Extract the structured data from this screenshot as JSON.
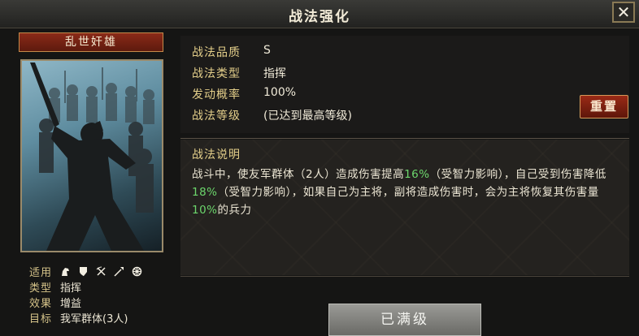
{
  "header": {
    "title": "战法强化",
    "close_icon": "close-icon"
  },
  "card": {
    "name": "乱世奸雄",
    "portrait_icon": "warrior-portrait-icon",
    "meta": [
      {
        "label": "适用",
        "icons": [
          "cavalry-icon",
          "shield-icon",
          "bow-icon",
          "spear-icon",
          "wheel-icon"
        ]
      },
      {
        "label": "类型",
        "value": "指挥"
      },
      {
        "label": "效果",
        "value": "增益"
      },
      {
        "label": "目标",
        "value": "我军群体(3人)"
      }
    ]
  },
  "info": {
    "quality_label": "战法品质",
    "quality_value": "S",
    "type_label": "战法类型",
    "type_value": "指挥",
    "rate_label": "发动概率",
    "rate_value": "100%",
    "level_label": "战法等级",
    "level_value": "(已达到最高等级)"
  },
  "reset_button": "重置",
  "description": {
    "title": "战法说明",
    "parts": [
      "战斗中，使友军群体（2人）造成伤害提高",
      "16%",
      "（受智力影响），自己受到伤害降低",
      "18%",
      "（受智力影响），如果自己为主将，副将造成伤害时，会为主将恢复其伤害量",
      "10%",
      "的兵力"
    ]
  },
  "maxed_button": "已满级",
  "colors": {
    "highlight": "#6cd66c",
    "accent_gold": "#e4cf8a",
    "button_red": "#9a2a16"
  }
}
